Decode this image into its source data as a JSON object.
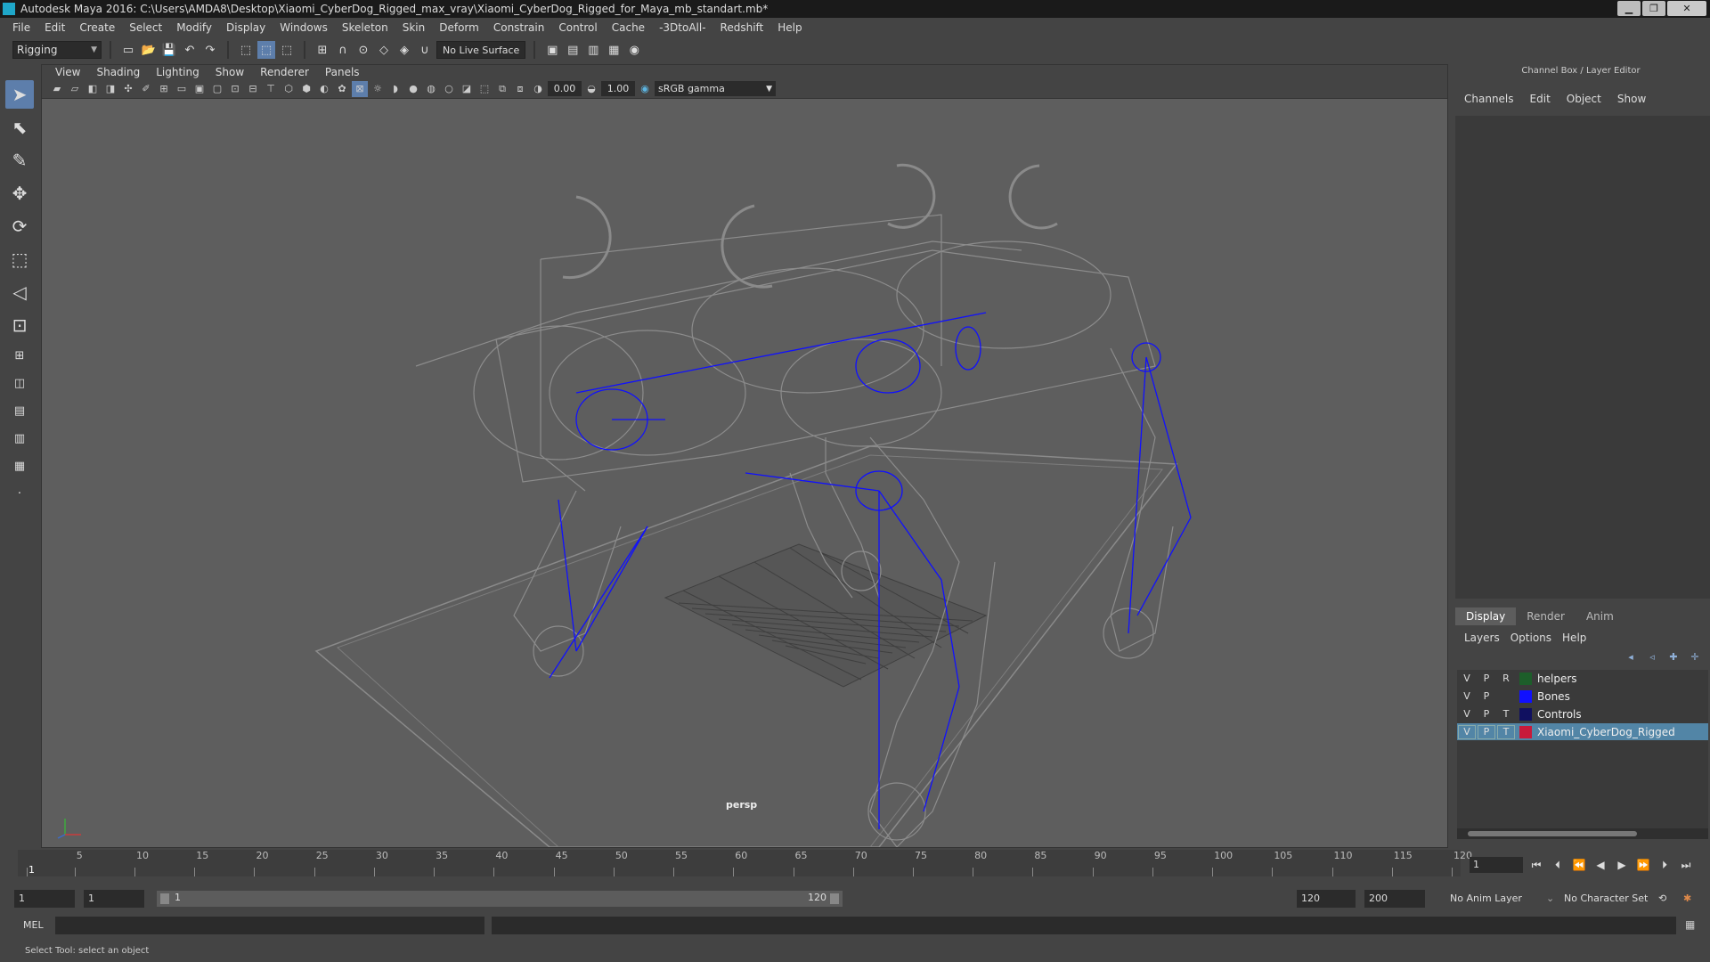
{
  "window": {
    "title": "Autodesk Maya 2016: C:\\Users\\AMDA8\\Desktop\\Xiaomi_CyberDog_Rigged_max_vray\\Xiaomi_CyberDog_Rigged_for_Maya_mb_standart.mb*",
    "minimize": "▁",
    "restore": "❐",
    "close": "✕"
  },
  "menubar": [
    "File",
    "Edit",
    "Create",
    "Select",
    "Modify",
    "Display",
    "Windows",
    "Skeleton",
    "Skin",
    "Deform",
    "Constrain",
    "Control",
    "Cache",
    "-3DtoAll-",
    "Redshift",
    "Help"
  ],
  "toolbar": {
    "menuset": "Rigging",
    "live_surface": "No Live Surface"
  },
  "viewport": {
    "menu": [
      "View",
      "Shading",
      "Lighting",
      "Show",
      "Renderer",
      "Panels"
    ],
    "exposure": "0.00",
    "gamma": "1.00",
    "colorspace": "sRGB gamma",
    "camera_label": "persp"
  },
  "right_panel": {
    "header": "Channel Box / Layer Editor",
    "tabs": [
      "Channels",
      "Edit",
      "Object",
      "Show"
    ],
    "lower_tabs": [
      "Display",
      "Render",
      "Anim"
    ],
    "layer_menu": [
      "Layers",
      "Options",
      "Help"
    ],
    "layers": [
      {
        "v": "V",
        "p": "P",
        "t": "R",
        "name": "helpers",
        "color": "#1d5e2a"
      },
      {
        "v": "V",
        "p": "P",
        "t": "",
        "name": "Bones",
        "color": "#1010ff"
      },
      {
        "v": "V",
        "p": "P",
        "t": "T",
        "name": "Controls",
        "color": "#101060"
      },
      {
        "v": "V",
        "p": "P",
        "t": "T",
        "name": "Xiaomi_CyberDog_Rigged",
        "color": "#c81a3a"
      }
    ]
  },
  "timeline": {
    "ticks": [
      "1",
      "5",
      "10",
      "15",
      "20",
      "25",
      "30",
      "35",
      "40",
      "45",
      "50",
      "55",
      "60",
      "65",
      "70",
      "75",
      "80",
      "85",
      "90",
      "95",
      "100",
      "105",
      "110",
      "115",
      "120"
    ],
    "current_frame": "1"
  },
  "range": {
    "start": "1",
    "playback_start": "1",
    "slider_start": "1",
    "slider_end": "120",
    "playback_end": "120",
    "end": "200",
    "anim_layer": "No Anim Layer",
    "character_set": "No Character Set"
  },
  "cmdline": {
    "label": "MEL"
  },
  "status": {
    "help_text": "Select Tool: select an object"
  },
  "colors": {
    "accent": "#5d7eab",
    "selected_layer": "#5285a6",
    "bones": "#1010ff"
  }
}
